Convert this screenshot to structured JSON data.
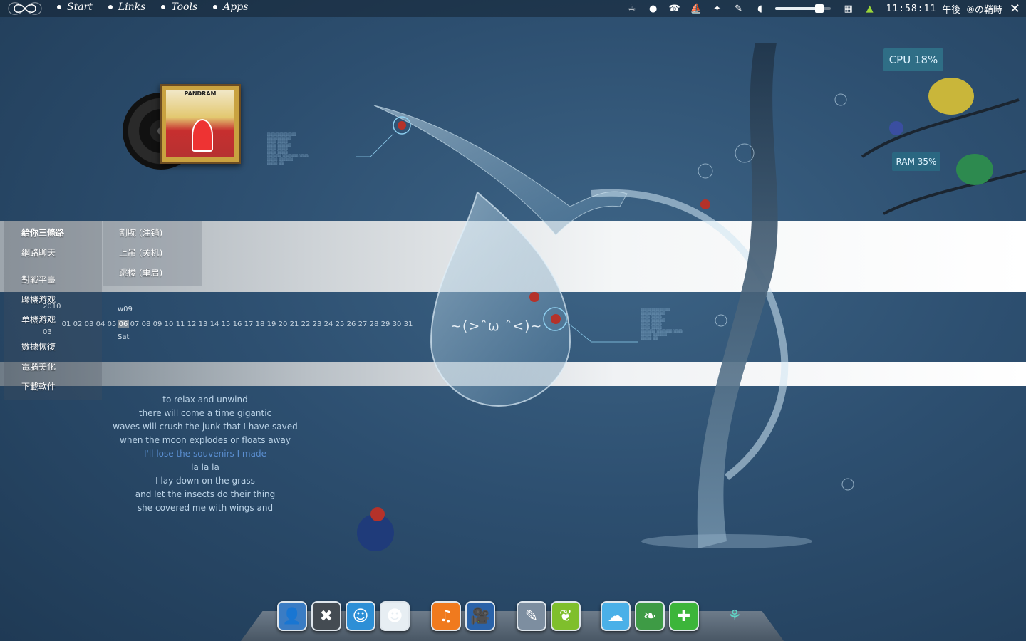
{
  "topbar": {
    "menu": [
      {
        "label": "Start"
      },
      {
        "label": "Links"
      },
      {
        "label": "Tools"
      },
      {
        "label": "Apps"
      }
    ],
    "tray_icons": [
      "cup-icon",
      "chat-bubble-icon",
      "phone-icon",
      "ship-icon",
      "bird-icon",
      "feather-icon",
      "speaker-icon"
    ],
    "volume_level": 0.85,
    "clock": "11:58:11",
    "ampm": "午後",
    "weather": "⑧の鞘時",
    "close": "✕"
  },
  "album": {
    "cover_title": "PANDRAM"
  },
  "left_menu": {
    "items": [
      "給你三條路",
      "網路聊天",
      "對戰平臺",
      "聯機游戏",
      "单機游戏",
      "數據恢復",
      "電腦美化",
      "下載軟件"
    ],
    "year": "2010",
    "month": "03"
  },
  "submenu": {
    "items": [
      "割腕 (注销)",
      "上吊 (关机)",
      "跳楼 (重启)"
    ]
  },
  "calendar": {
    "week": "w09",
    "days": [
      "01",
      "02",
      "03",
      "04",
      "05",
      "06",
      "07",
      "08",
      "09",
      "10",
      "11",
      "12",
      "13",
      "14",
      "15",
      "16",
      "17",
      "18",
      "19",
      "20",
      "21",
      "22",
      "23",
      "24",
      "25",
      "26",
      "27",
      "28",
      "29",
      "30",
      "31"
    ],
    "today": "06",
    "dow": "Sat"
  },
  "lyrics": [
    "to relax and unwind",
    "there will come a time gigantic",
    "waves will crush the junk that I have saved",
    "when the moon explodes or floats away",
    "I'll lose the souvenirs I made",
    "la la la",
    "I lay down on the grass",
    "and let the insects do their thing",
    "she covered me with wings and"
  ],
  "lyrics_current_index": 4,
  "kaomoji": "~(>ˆω ˆ<)~",
  "monitor": {
    "cpu": "CPU 18%",
    "ram": "RAM 35%"
  },
  "dock": [
    {
      "name": "contacts-app-icon",
      "glyph": "👤",
      "color": "#3a7cc4"
    },
    {
      "name": "crossed-tools-app-icon",
      "glyph": "✖",
      "color": "#444b52"
    },
    {
      "name": "finder-face-app-icon",
      "glyph": "☺",
      "color": "#2d8fd6"
    },
    {
      "name": "reddit-alien-app-icon",
      "glyph": "☻",
      "color": "#e7eef3"
    },
    {
      "name": "music-app-icon",
      "glyph": "♫",
      "color": "#f07a1e"
    },
    {
      "name": "video-camera-app-icon",
      "glyph": "🎥",
      "color": "#2a62a8"
    },
    {
      "name": "pencil-app-icon",
      "glyph": "✎",
      "color": "#7d8ea0"
    },
    {
      "name": "leaf-app-icon",
      "glyph": "❦",
      "color": "#7fbf2c"
    },
    {
      "name": "cloud-app-icon",
      "glyph": "☁",
      "color": "#4ab0e8"
    },
    {
      "name": "fern-app-icon",
      "glyph": "❧",
      "color": "#3e9b45"
    },
    {
      "name": "plus-app-icon",
      "glyph": "✚",
      "color": "#3cb53a"
    },
    {
      "name": "butterfly-app-icon",
      "glyph": "⚘",
      "color": "transparent"
    }
  ],
  "colors": {
    "background": "#2d4f70",
    "accent_blue": "#5a8ed0",
    "monitor_bubble": "#2f6e86"
  }
}
